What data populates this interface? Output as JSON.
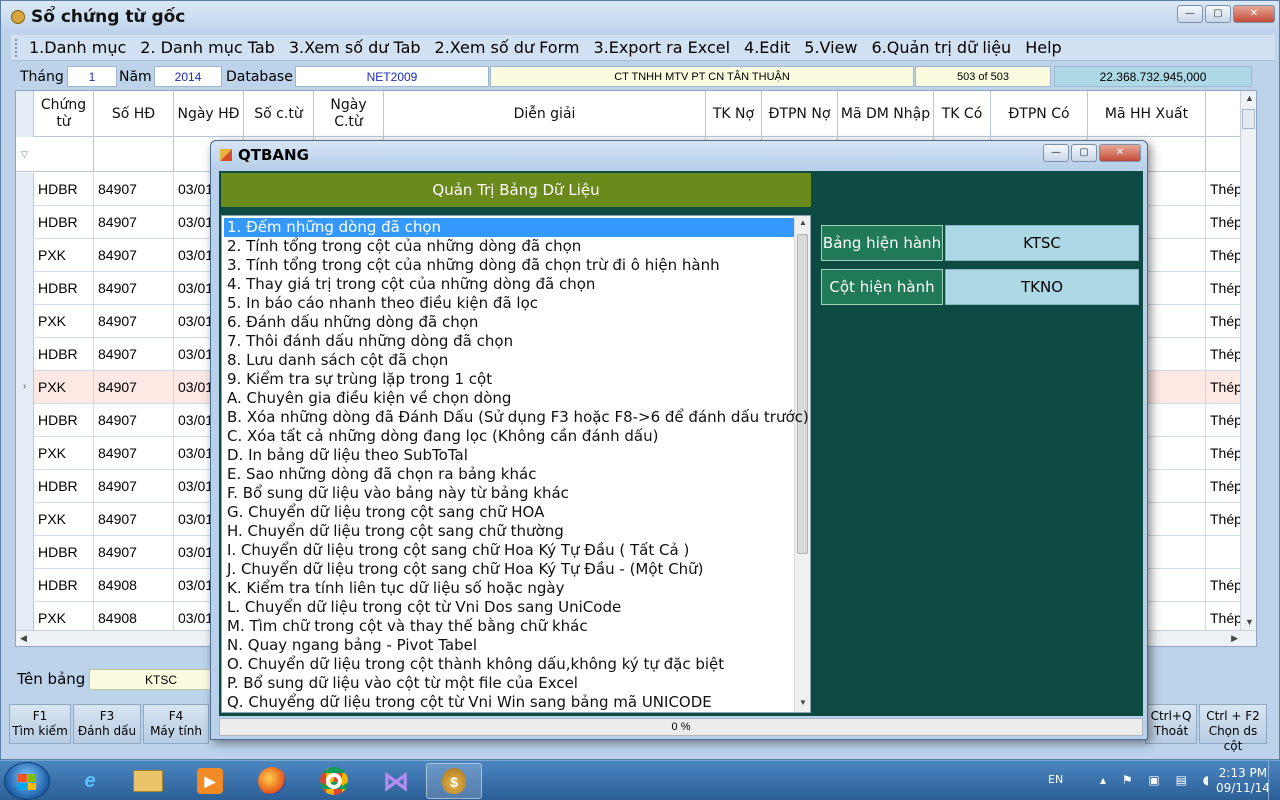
{
  "window": {
    "title": "Sổ chứng từ gốc"
  },
  "menu": [
    "1.Danh mục",
    "2. Danh mục Tab",
    "3.Xem số dư Tab",
    "2.Xem số dư Form",
    "3.Export ra Excel",
    "4.Edit",
    "5.View",
    "6.Quản trị dữ liệu",
    "Help"
  ],
  "info": {
    "thang_label": "Tháng",
    "thang": "1",
    "nam_label": "Năm",
    "nam": "2014",
    "database_label": "Database",
    "database": "NET2009",
    "company": "CT TNHH MTV PT CN TÂN THUẬN",
    "record": "503 of 503",
    "total": "22.368.732.945,000"
  },
  "grid": {
    "columns": [
      "Chứng từ",
      "Số HĐ",
      "Ngày HĐ",
      "Số c.từ",
      "Ngày C.từ",
      "Diễn giải",
      "TK Nợ",
      "ĐTPN Nợ",
      "Mã DM Nhập",
      "TK Có",
      "ĐTPN Có",
      "Mã HH Xuất",
      ""
    ],
    "rows": [
      {
        "ct": "HDBR",
        "so_hd": "84907",
        "ngay_hd": "03/01",
        "last": "Thép"
      },
      {
        "ct": "HDBR",
        "so_hd": "84907",
        "ngay_hd": "03/01",
        "last": "Thép"
      },
      {
        "ct": "PXK",
        "so_hd": "84907",
        "ngay_hd": "03/01",
        "last": "Thép"
      },
      {
        "ct": "HDBR",
        "so_hd": "84907",
        "ngay_hd": "03/01",
        "last": "Thép"
      },
      {
        "ct": "PXK",
        "so_hd": "84907",
        "ngay_hd": "03/01",
        "last": "Thép"
      },
      {
        "ct": "HDBR",
        "so_hd": "84907",
        "ngay_hd": "03/01",
        "last": "Thép"
      },
      {
        "ct": "PXK",
        "so_hd": "84907",
        "ngay_hd": "03/01",
        "last": "Thép"
      },
      {
        "ct": "HDBR",
        "so_hd": "84907",
        "ngay_hd": "03/01",
        "last": "Thép"
      },
      {
        "ct": "PXK",
        "so_hd": "84907",
        "ngay_hd": "03/01",
        "last": "Thép"
      },
      {
        "ct": "HDBR",
        "so_hd": "84907",
        "ngay_hd": "03/01",
        "last": "Thép"
      },
      {
        "ct": "PXK",
        "so_hd": "84907",
        "ngay_hd": "03/01",
        "last": "Thép"
      },
      {
        "ct": "HDBR",
        "so_hd": "84907",
        "ngay_hd": "03/01",
        "last": ""
      },
      {
        "ct": "HDBR",
        "so_hd": "84908",
        "ngay_hd": "03/01",
        "last": "Thép"
      },
      {
        "ct": "PXK",
        "so_hd": "84908",
        "ngay_hd": "03/01",
        "last": "Thép"
      }
    ],
    "selected_index": 6
  },
  "table_name": {
    "label": "Tên bảng",
    "value": "KTSC"
  },
  "fkeys": [
    {
      "key": "F1",
      "action": "Tìm kiếm"
    },
    {
      "key": "F3",
      "action": "Đánh dấu"
    },
    {
      "key": "F4",
      "action": "Máy tính"
    },
    {
      "key": "Ctrl+Q",
      "action": "Thoát"
    },
    {
      "key": "Ctrl + F2",
      "action": "Chọn ds cột"
    }
  ],
  "dialog": {
    "title": "QTBANG",
    "header": "Quản Trị Bảng Dữ Liệu",
    "items": [
      "1. Đếm những dòng đã chọn",
      "2. Tính tổng trong cột của những dòng đã chọn",
      "3. Tính tổng trong cột của những dòng đã chọn trừ đi ô hiện hành",
      "4. Thay giá trị trong cột của những dòng đã chọn",
      "5. In báo cáo nhanh theo điều kiện đã lọc",
      "6. Đánh dấu những dòng đã chọn",
      "7. Thôi đánh dấu những dòng đã chọn",
      "8. Lưu danh sách cột đã chọn",
      "9. Kiểm tra sự trùng lặp trong 1 cột",
      "A. Chuyên gia điều kiện về chọn dòng",
      "B. Xóa những dòng đã Đánh Dấu (Sử dụng F3 hoặc F8->6 để đánh dấu trước)",
      "C. Xóa tất cả những dòng đang lọc (Không cần đánh dấu)",
      "D. In bảng dữ liệu theo SubToTal",
      "E. Sao những dòng đã chọn ra bảng khác",
      "F. Bổ sung dữ liệu vào bảng này từ bảng khác",
      "G. Chuyển dữ liệu trong cột sang chữ HOA",
      "H. Chuyển dữ liệu trong cột sang chữ thường",
      "I. Chuyển dữ liệu trong cột sang chữ Hoa Ký Tự Đầu ( Tất Cả )",
      "J. Chuyển dữ liệu trong cột sang chữ Hoa Ký Tự Đầu - (Một Chữ)",
      "K. Kiểm tra tính liên tục dữ liệu số hoặc ngày",
      "L. Chuyển dữ liệu trong cột từ Vni Dos sang UniCode",
      "M. Tìm chữ trong cột và thay thế bằng chữ khác",
      "N. Quay ngang bảng  - Pivot Tabel",
      "O. Chuyển dữ liệu trong cột thành không dấu,không ký tự đặc biệt",
      "P. Bổ sung dữ liệu vào cột từ một file của Excel",
      "Q. Chuyểng dữ liệu trong cột từ Vni Win sang bảng mã UNICODE"
    ],
    "current_table_label": "Bảng hiện hành",
    "current_table": "KTSC",
    "current_column_label": "Cột hiện hành",
    "current_column": "TKNO",
    "progress": "0 %"
  },
  "taskbar": {
    "lang": "EN",
    "time": "2:13 PM",
    "date": "09/11/14"
  }
}
